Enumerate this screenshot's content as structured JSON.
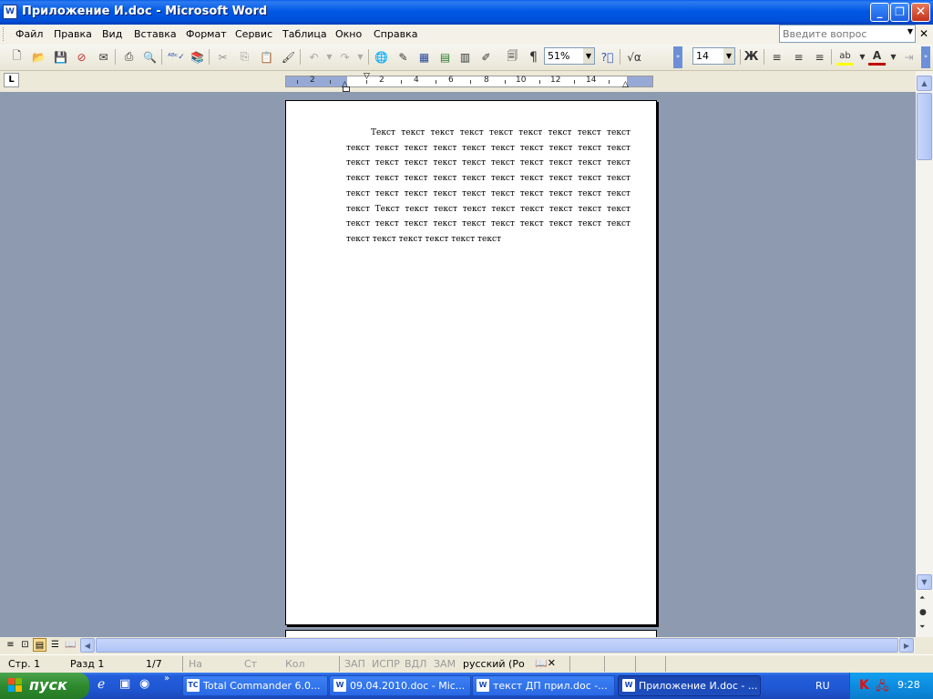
{
  "window": {
    "title": "Приложение И.doc - Microsoft Word",
    "app_icon": "W"
  },
  "menu": {
    "items": [
      "Файл",
      "Правка",
      "Вид",
      "Вставка",
      "Формат",
      "Сервис",
      "Таблица",
      "Окно",
      "Справка"
    ],
    "help_placeholder": "Введите вопрос"
  },
  "toolbar": {
    "zoom": "51%",
    "font_size": "14",
    "bold_label": "Ж",
    "pilcrow": "¶"
  },
  "ruler": {
    "numbers": [
      "2",
      "2",
      "4",
      "6",
      "8",
      "10",
      "12",
      "14"
    ]
  },
  "document": {
    "text": "Текст текст текст текст текст текст текст текст текст текст текст текст текст текст текст текст текст текст текст текст текст текст текст текст текст текст текст текст текст текст текст текст текст текст текст текст текст текст текст текст текст текст текст текст текст текст текст текст текст текст Текст текст текст текст текст текст текст текст текст текст текст текст текст текст текст текст текст текст текст текст текст текст текст текст текст"
  },
  "status": {
    "page": "Стр. 1",
    "section": "Разд 1",
    "pages": "1/7",
    "at": "На",
    "line": "Ст",
    "col": "Кол",
    "rec": "ЗАП",
    "trk": "ИСПР",
    "ext": "ВДЛ",
    "ovr": "ЗАМ",
    "language": "русский (Ро"
  },
  "taskbar": {
    "start": "пуск",
    "tasks": [
      {
        "label": "Total Commander 6.0...",
        "icon": "TC"
      },
      {
        "label": "09.04.2010.doc - Mic...",
        "icon": "W"
      },
      {
        "label": "текст ДП прил.doc -...",
        "icon": "W"
      },
      {
        "label": "Приложение И.doc - ...",
        "icon": "W"
      }
    ],
    "language": "RU",
    "clock": "9:28"
  },
  "colors": {
    "titlebar": "#0058E6",
    "doc_background": "#8E9AB0",
    "taskbar": "#245EDB",
    "start": "#2E8A2E"
  }
}
